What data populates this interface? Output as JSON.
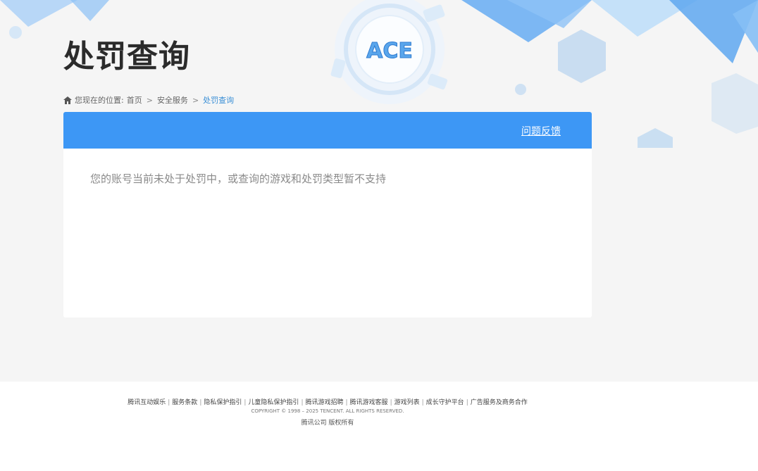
{
  "header": {
    "title": "处罚查询",
    "logo_text": "ACE"
  },
  "breadcrumb": {
    "prefix": "您现在的位置:",
    "items": [
      "首页",
      "安全服务",
      "处罚查询"
    ],
    "separator": ">"
  },
  "panel": {
    "feedback_label": "问题反馈",
    "message": "您的账号当前未处于处罚中，或查询的游戏和处罚类型暂不支持"
  },
  "footer": {
    "links": [
      "腾讯互动娱乐",
      "服务条款",
      "隐私保护指引",
      "儿童隐私保护指引",
      "腾讯游戏招聘",
      "腾讯游戏客服",
      "游戏列表",
      "成长守护平台",
      "广告服务及商务合作"
    ],
    "copyright": "COPYRIGHT © 1998 – 2025 TENCENT. ALL RIGHTS RESERVED.",
    "company": "腾讯公司 版权所有"
  },
  "colors": {
    "accent": "#3d97f5",
    "link_current": "#3a8fd6",
    "background": "#f5f5f5"
  }
}
